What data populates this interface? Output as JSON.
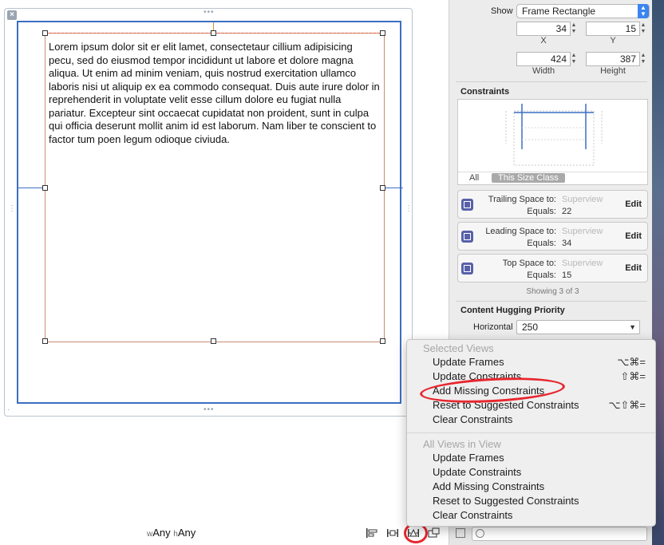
{
  "canvas": {
    "lorem_text": "Lorem ipsum dolor sit er elit lamet, consectetaur cillium adipisicing pecu, sed do eiusmod tempor incididunt ut labore et dolore magna aliqua. Ut enim ad minim veniam, quis nostrud exercitation ullamco laboris nisi ut aliquip ex ea commodo consequat. Duis aute irure dolor in reprehenderit in voluptate velit esse cillum dolore eu fugiat nulla pariatur. Excepteur sint occaecat cupidatat non proident, sunt in culpa qui officia deserunt mollit anim id est laborum. Nam liber te conscient to factor tum poen legum odioque civiuda.",
    "size_class": {
      "w_prefix": "w",
      "w_value": "Any",
      "h_prefix": "h",
      "h_value": "Any"
    },
    "close_glyph": "×",
    "grip_glyph": "•••"
  },
  "inspector": {
    "show_label": "Show",
    "show_value": "Frame Rectangle",
    "x_value": "34",
    "y_value": "15",
    "x_label": "X",
    "y_label": "Y",
    "width_value": "424",
    "height_value": "387",
    "width_label": "Width",
    "height_label": "Height",
    "constraints_title": "Constraints",
    "tab_all": "All",
    "tab_size_class": "This Size Class",
    "constraints": [
      {
        "title": "Trailing Space to:",
        "target": "Superview",
        "equals_label": "Equals:",
        "value": "22",
        "edit": "Edit"
      },
      {
        "title": "Leading Space to:",
        "target": "Superview",
        "equals_label": "Equals:",
        "value": "34",
        "edit": "Edit"
      },
      {
        "title": "Top Space to:",
        "target": "Superview",
        "equals_label": "Equals:",
        "value": "15",
        "edit": "Edit"
      }
    ],
    "showing_text": "Showing 3 of 3",
    "hugging_title": "Content Hugging Priority",
    "horizontal_label": "Horizontal",
    "horizontal_value": "250"
  },
  "menu": {
    "selected_header": "Selected Views",
    "selected_items": [
      {
        "label": "Update Frames",
        "shortcut": "⌥⌘="
      },
      {
        "label": "Update Constraints",
        "shortcut": "⇧⌘="
      },
      {
        "label": "Add Missing Constraints",
        "shortcut": ""
      },
      {
        "label": "Reset to Suggested Constraints",
        "shortcut": "⌥⇧⌘="
      },
      {
        "label": "Clear Constraints",
        "shortcut": ""
      }
    ],
    "all_header": "All Views in View",
    "all_items": [
      {
        "label": "Update Frames"
      },
      {
        "label": "Update Constraints"
      },
      {
        "label": "Add Missing Constraints"
      },
      {
        "label": "Reset to Suggested Constraints"
      },
      {
        "label": "Clear Constraints"
      }
    ]
  },
  "colors": {
    "constraint_blue": "#3b6fc2",
    "highlight_red": "#e8262e",
    "selection_orange": "#e0542e",
    "popup_accent": "#3a85f0"
  }
}
